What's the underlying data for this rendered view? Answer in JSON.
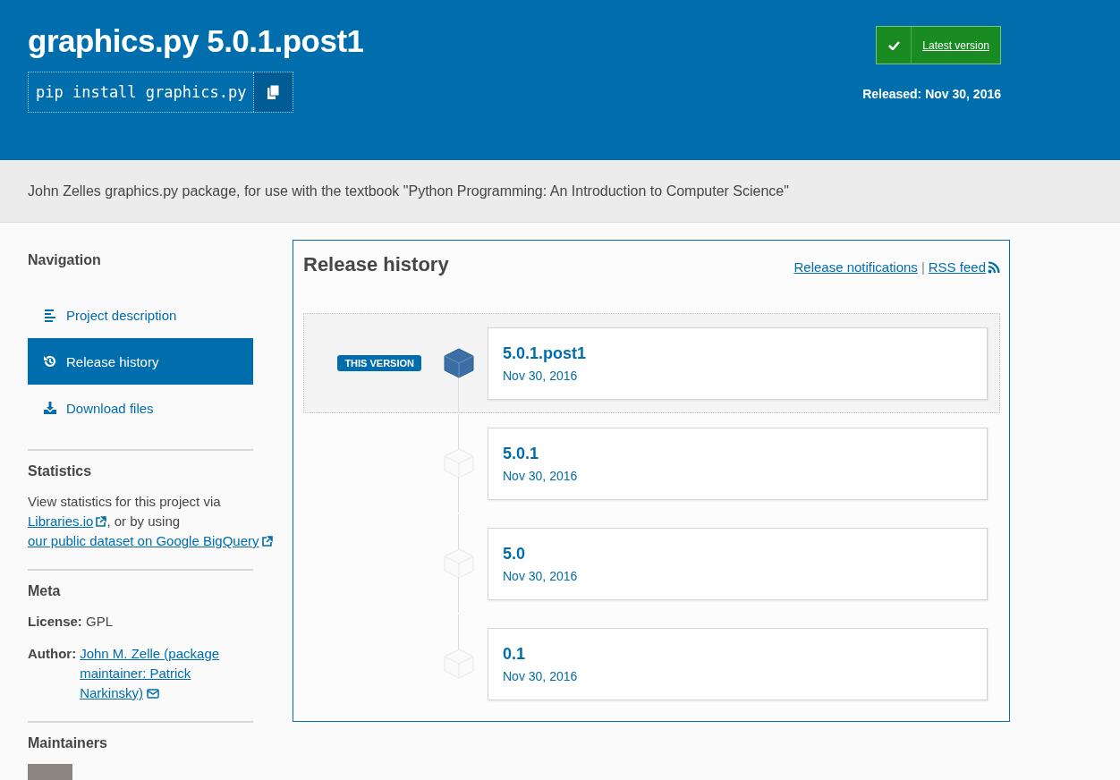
{
  "header": {
    "title": "graphics.py 5.0.1.post1",
    "pip_command": "pip install graphics.py",
    "latest_button": "Latest version",
    "released": "Released: Nov 30, 2016"
  },
  "description": "John Zelles graphics.py package, for use with the textbook \"Python Programming: An Introduction to Computer Science\"",
  "sidebar": {
    "navigation": {
      "heading": "Navigation",
      "items": [
        {
          "label": "Project description",
          "kind": "description",
          "selected": false
        },
        {
          "label": "Release history",
          "kind": "history",
          "selected": true
        },
        {
          "label": "Download files",
          "kind": "download",
          "selected": false
        }
      ]
    },
    "statistics": {
      "heading": "Statistics",
      "parts": [
        {
          "kind": "text",
          "text": "View statistics for this project via "
        },
        {
          "kind": "link",
          "text": "Libraries.io"
        },
        {
          "kind": "text",
          "text": ", or by using "
        },
        {
          "kind": "link",
          "text": "our public dataset on Google BigQuery"
        }
      ]
    },
    "meta": {
      "heading": "Meta",
      "license_label": "License:",
      "license": "GPL",
      "author_label": "Author:",
      "author": "John M. Zelle (package maintainer: Patrick Narkinsky)"
    },
    "maintainers": {
      "heading": "Maintainers"
    }
  },
  "release_history": {
    "title": "Release history",
    "notifications_link": "Release notifications",
    "separator": "|",
    "rss_link": "RSS feed",
    "releases": [
      {
        "version": "5.0.1.post1",
        "date": "Nov 30, 2016",
        "selected": true,
        "badge": "THIS VERSION"
      },
      {
        "version": "5.0.1",
        "date": "Nov 30, 2016",
        "selected": false
      },
      {
        "version": "5.0",
        "date": "Nov 30, 2016",
        "selected": false
      },
      {
        "version": "0.1",
        "date": "Nov 30, 2016",
        "selected": false
      }
    ]
  }
}
